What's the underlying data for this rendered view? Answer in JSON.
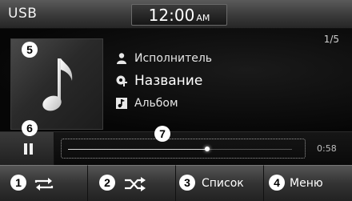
{
  "header": {
    "source": "USB",
    "clock_time": "12:00",
    "clock_ampm": "AM"
  },
  "track": {
    "counter": "1/5",
    "artist": "Исполнитель",
    "title": "Название",
    "album": "Альбом",
    "elapsed": "0:58",
    "progress_fraction": 0.62
  },
  "badges": {
    "repeat": "1",
    "shuffle": "2",
    "list": "3",
    "menu": "4",
    "album_art": "5",
    "play_pause": "6",
    "progress_bar": "7"
  },
  "softkeys": {
    "repeat_icon": "repeat-icon",
    "shuffle_icon": "shuffle-icon",
    "list_label": "Список",
    "menu_label": "Меню"
  },
  "icons": {
    "artist": "person-icon",
    "title": "music-title-icon",
    "album": "album-icon",
    "album_art": "music-note-icon",
    "play_pause": "pause-icon"
  },
  "colors": {
    "background": "#000000",
    "text": "#ffffff",
    "badge": "#ffffff"
  }
}
